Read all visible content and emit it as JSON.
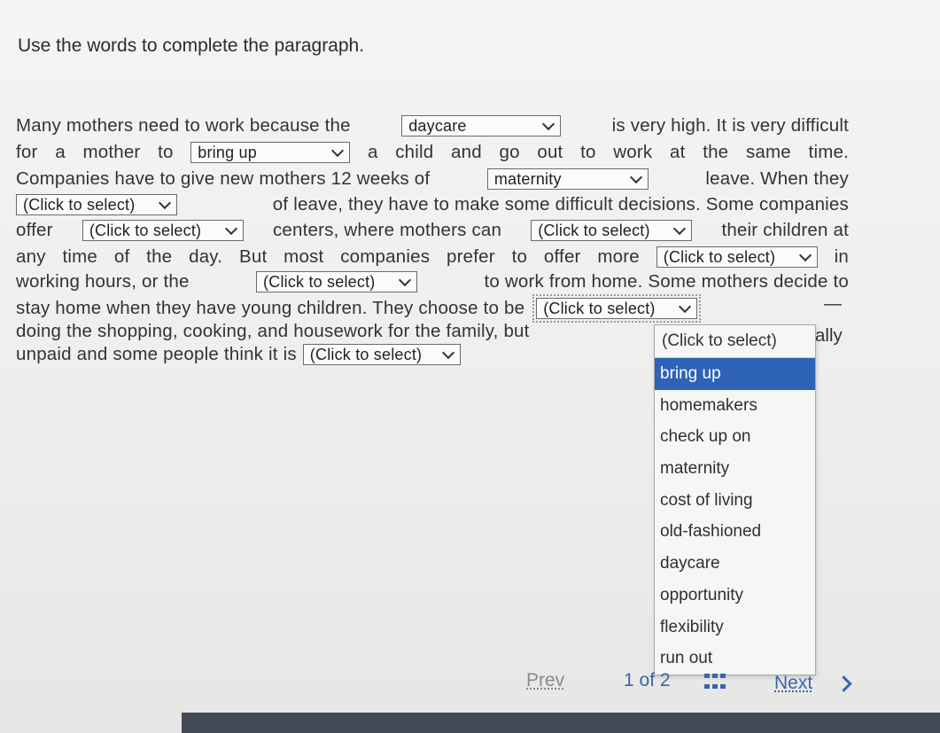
{
  "instructions": "Use the words to complete the paragraph.",
  "paragraph": {
    "l1": [
      "Many mothers need to work because the",
      "is very high. It is very difficult"
    ],
    "l2": [
      "for",
      "a",
      "mother",
      "to",
      "a",
      "child",
      "and",
      "go",
      "out",
      "to",
      "work",
      "at",
      "the",
      "same",
      "time."
    ],
    "l3": [
      "Companies have to give new mothers 12 weeks of",
      "leave. When they"
    ],
    "l4": [
      "of leave, they have to make some difficult decisions. Some companies"
    ],
    "l5": [
      "offer",
      "centers, where mothers can",
      "their children at"
    ],
    "l6": [
      "any",
      "time",
      "of",
      "the",
      "day.",
      "But",
      "most",
      "companies",
      "prefer",
      "to",
      "offer",
      "more",
      "in"
    ],
    "l7": [
      "working hours, or the",
      "to work from home. Some mothers decide to"
    ],
    "l8": [
      "stay home when they have young children. They choose to be"
    ],
    "l9": [
      "doing the shopping, cooking, and housework for the family, but"
    ],
    "l10": [
      "unpaid and some people think it is"
    ]
  },
  "blanks": {
    "b1": "daycare",
    "b2": "bring up",
    "b3": "maternity",
    "b4": "(Click to select)",
    "b5": "(Click to select)",
    "b6": "(Click to select)",
    "b7": "(Click to select)",
    "b8": "(Click to select)",
    "b9": "(Click to select)",
    "b10": "(Click to select)"
  },
  "dropdown": {
    "header": "(Click to select)",
    "options": [
      "bring up",
      "homemakers",
      "check up on",
      "maternity",
      "cost of living",
      "old-fashioned",
      "daycare",
      "opportunity",
      "flexibility",
      "run out"
    ],
    "highlighted": "bring up"
  },
  "partial_word": "ally",
  "dash": "—",
  "pager": {
    "prev": "Prev",
    "count": "1 of 2",
    "next": "Next"
  }
}
